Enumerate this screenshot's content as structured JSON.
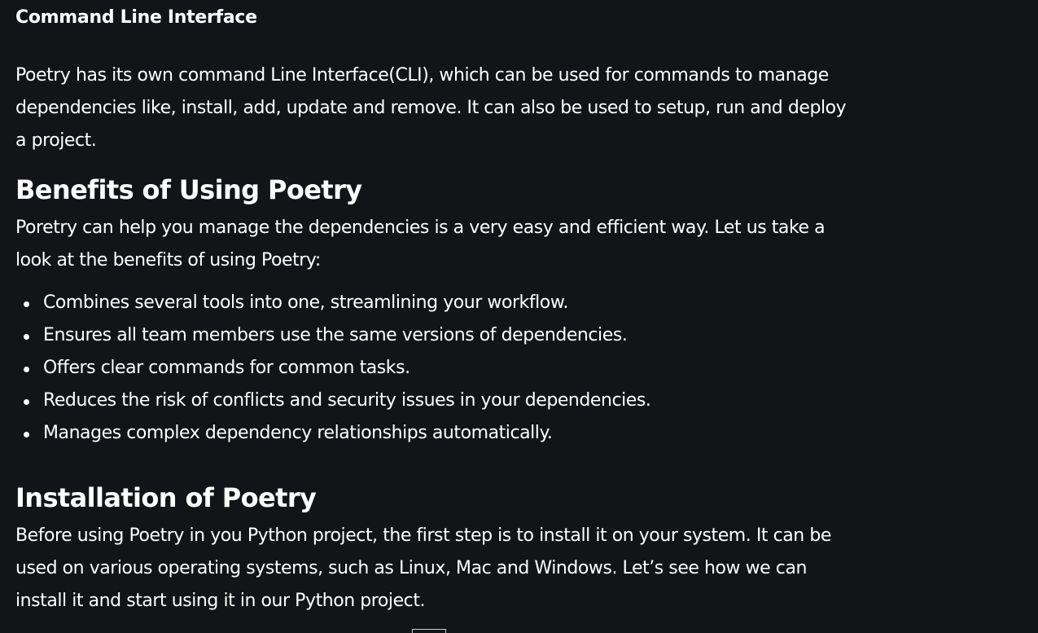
{
  "section_cli": {
    "title": "Command Line Interface",
    "paragraph": "Poetry has its own command Line Interface(CLI), which can be used for commands to manage dependencies like, install, add, update and remove. It can also be used to setup, run and deploy a project."
  },
  "section_benefits": {
    "heading": "Benefits of Using Poetry",
    "intro": "Poretry can help you manage the dependencies is a very easy and efficient way. Let us take a look at the benefits of using Poetry:",
    "items": [
      "Combines several tools into one, streamlining your workflow.",
      "Ensures all team members use the same versions of dependencies.",
      "Offers clear commands for common tasks.",
      "Reduces the risk of conflicts and security issues in your dependencies.",
      "Manages complex dependency relationships automatically."
    ]
  },
  "section_install": {
    "heading": "Installation of Poetry",
    "paragraph": "Before using Poetry in you Python project, the first step is to install it on your system. It can be used on various operating systems, such as Linux, Mac and Windows. Let’s see how we can install it and start using it in our Python project."
  }
}
